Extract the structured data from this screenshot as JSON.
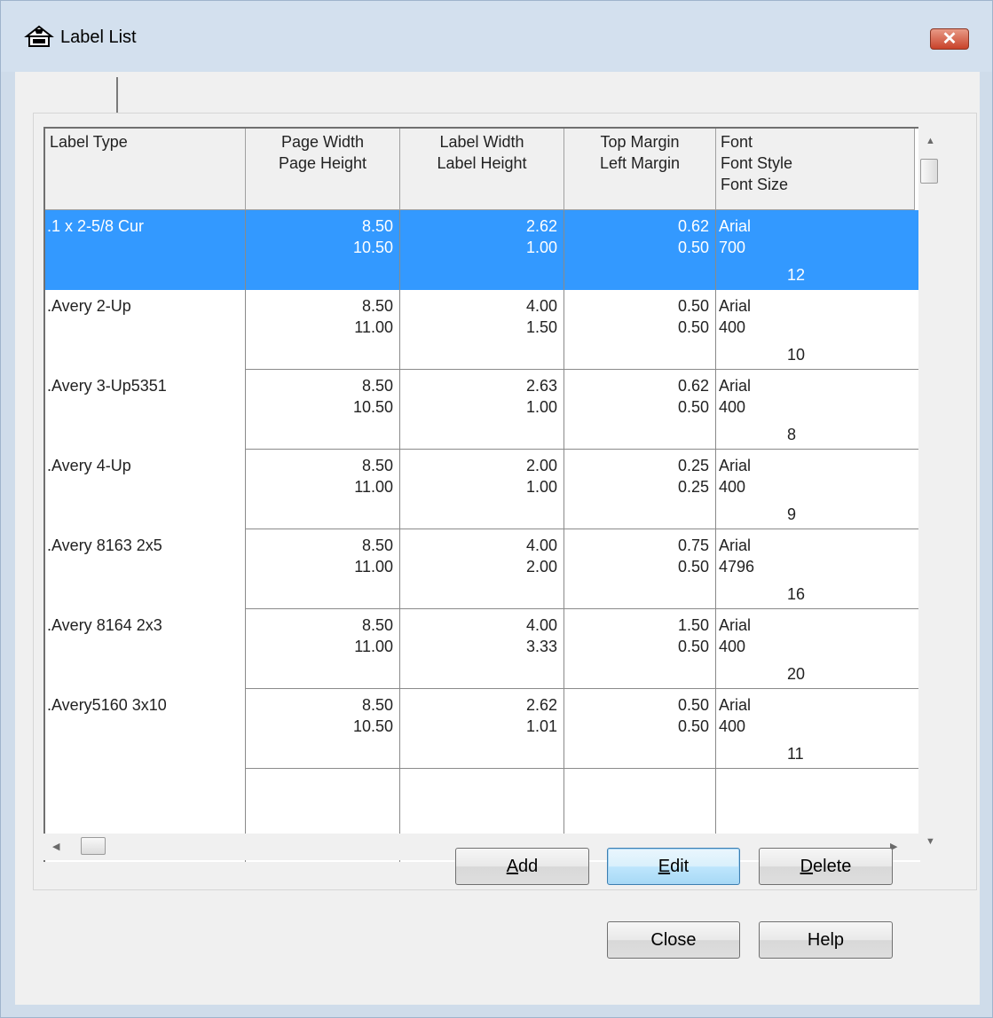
{
  "window": {
    "title": "Label List",
    "close_glyph": "✕"
  },
  "tabs": [
    {
      "label": ""
    }
  ],
  "grid": {
    "columns": [
      {
        "line1": "Label Type",
        "line2": "",
        "line3": ""
      },
      {
        "line1": "Page Width",
        "line2": "Page Height",
        "line3": ""
      },
      {
        "line1": "Label Width",
        "line2": "Label Height",
        "line3": ""
      },
      {
        "line1": "Top Margin",
        "line2": "Left Margin",
        "line3": ""
      },
      {
        "line1": "Font",
        "line2": "Font Style",
        "line3": "Font Size"
      }
    ],
    "rows": [
      {
        "type": ".1 x 2-5/8  Cur",
        "page_width": "8.50",
        "page_height": "10.50",
        "label_width": "2.62",
        "label_height": "1.00",
        "top_margin": "0.62",
        "left_margin": "0.50",
        "font": "Arial",
        "font_style": "700",
        "font_size": "12",
        "selected": true
      },
      {
        "type": ".Avery 2-Up",
        "page_width": "8.50",
        "page_height": "11.00",
        "label_width": "4.00",
        "label_height": "1.50",
        "top_margin": "0.50",
        "left_margin": "0.50",
        "font": "Arial",
        "font_style": "400",
        "font_size": "10",
        "selected": false
      },
      {
        "type": ".Avery 3-Up5351",
        "page_width": "8.50",
        "page_height": "10.50",
        "label_width": "2.63",
        "label_height": "1.00",
        "top_margin": "0.62",
        "left_margin": "0.50",
        "font": "Arial",
        "font_style": "400",
        "font_size": "8",
        "selected": false
      },
      {
        "type": ".Avery 4-Up",
        "page_width": "8.50",
        "page_height": "11.00",
        "label_width": "2.00",
        "label_height": "1.00",
        "top_margin": "0.25",
        "left_margin": "0.25",
        "font": "Arial",
        "font_style": "400",
        "font_size": "9",
        "selected": false
      },
      {
        "type": ".Avery 8163 2x5",
        "page_width": "8.50",
        "page_height": "11.00",
        "label_width": "4.00",
        "label_height": "2.00",
        "top_margin": "0.75",
        "left_margin": "0.50",
        "font": "Arial",
        "font_style": "4796",
        "font_size": "16",
        "selected": false
      },
      {
        "type": ".Avery 8164 2x3",
        "page_width": "8.50",
        "page_height": "11.00",
        "label_width": "4.00",
        "label_height": "3.33",
        "top_margin": "1.50",
        "left_margin": "0.50",
        "font": "Arial",
        "font_style": "400",
        "font_size": "20",
        "selected": false
      },
      {
        "type": ".Avery5160 3x10",
        "page_width": "8.50",
        "page_height": "10.50",
        "label_width": "2.62",
        "label_height": "1.01",
        "top_margin": "0.50",
        "left_margin": "0.50",
        "font": "Arial",
        "font_style": "400",
        "font_size": "11",
        "selected": false
      }
    ]
  },
  "buttons": {
    "add": {
      "mnemonic": "A",
      "rest": "dd"
    },
    "edit": {
      "mnemonic": "E",
      "rest": "dit"
    },
    "delete": {
      "mnemonic": "D",
      "rest": "elete"
    },
    "close": "Close",
    "help": "Help"
  },
  "scroll": {
    "up": "▲",
    "down": "▼",
    "left": "◀",
    "right": "▶"
  }
}
